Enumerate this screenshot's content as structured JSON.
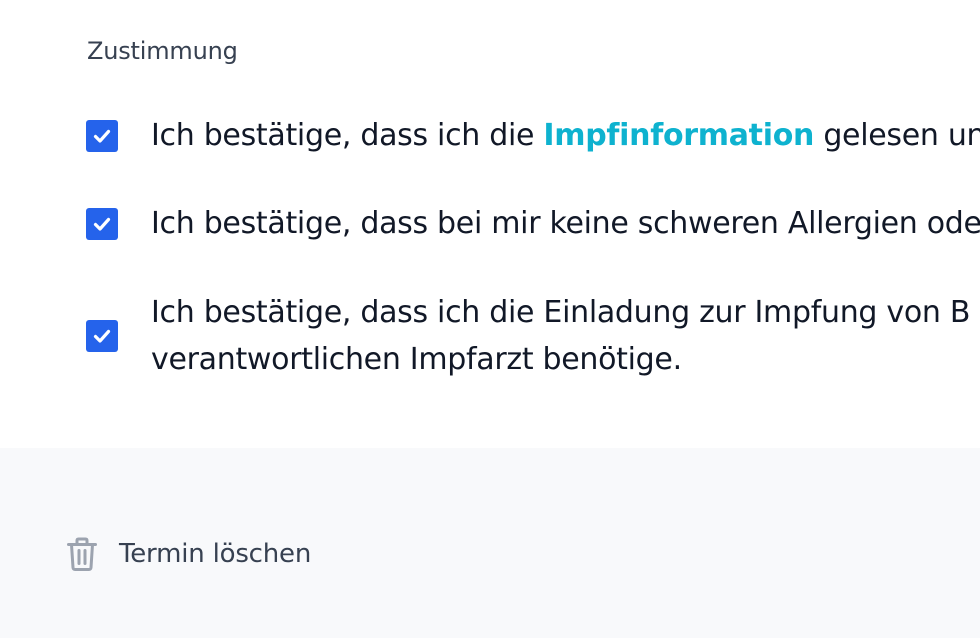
{
  "consent": {
    "heading": "Zustimmung",
    "items": [
      {
        "checked": true,
        "prefix": "Ich bestätige, dass ich die ",
        "link": "Impfinformation",
        "suffix": " gelesen und"
      },
      {
        "checked": true,
        "text": "Ich bestätige, dass bei mir keine schweren Allergien oder"
      },
      {
        "checked": true,
        "line1": "Ich bestätige, dass ich die Einladung zur Impfung von B",
        "line2": "verantwortlichen Impfarzt benötige."
      }
    ]
  },
  "footer": {
    "delete_label": "Termin löschen",
    "delete_icon": "trash-icon"
  },
  "colors": {
    "checkbox": "#2563eb",
    "link": "#0eb2cf",
    "footer_bg": "#f8f9fb",
    "text": "#111827",
    "muted_text": "#374151",
    "icon": "#9ca3af"
  }
}
